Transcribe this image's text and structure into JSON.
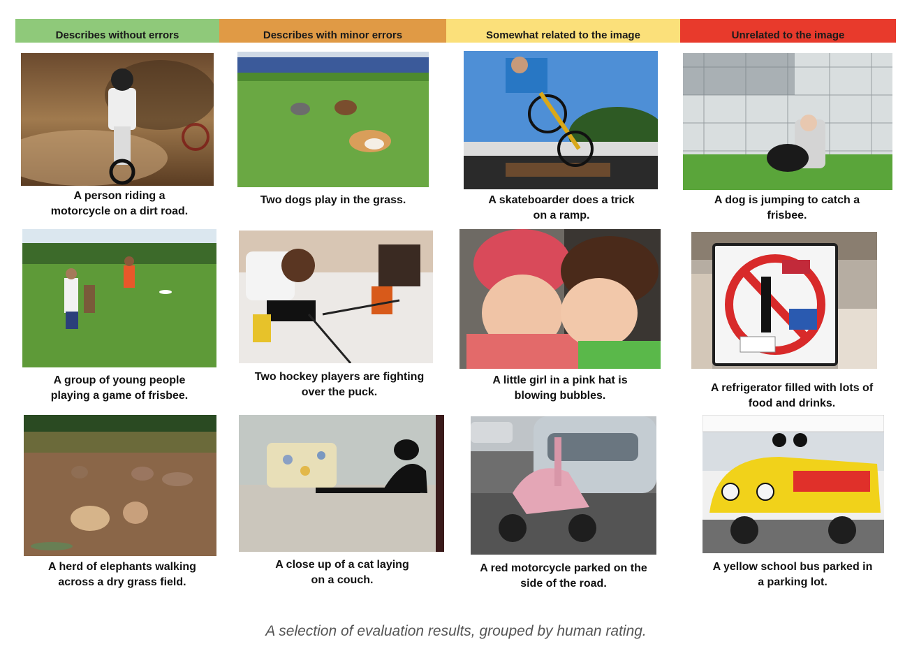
{
  "categories": [
    {
      "label": "Describes without errors",
      "color": "#8fc97a"
    },
    {
      "label": "Describes with minor errors",
      "color": "#e09a45"
    },
    {
      "label": "Somewhat related to the image",
      "color": "#fbe07a"
    },
    {
      "label": "Unrelated to the image",
      "color": "#e83a2c"
    }
  ],
  "rows": [
    [
      {
        "caption": "A person riding a\nmotorcycle on a dirt road.",
        "photo": "motocross-rider"
      },
      {
        "caption": "Two dogs play in the grass.",
        "photo": "dogs-running-on-grass"
      },
      {
        "caption": "A skateboarder does a trick\non a ramp.",
        "photo": "bmx-rider-on-ramp"
      },
      {
        "caption": "A dog is jumping to catch a\nfrisbee.",
        "photo": "woman-with-dog-by-fence"
      }
    ],
    [
      {
        "caption": "A group of young people\nplaying a game of frisbee.",
        "photo": "frisbee-players-on-field"
      },
      {
        "caption": "Two hockey players are fighting\nover the puck.",
        "photo": "hockey-players-on-ice"
      },
      {
        "caption": "A little girl in a pink hat is\nblowing bubbles.",
        "photo": "children-in-winter-hats"
      },
      {
        "caption": "A refrigerator filled with lots of\nfood and drinks.",
        "photo": "no-parking-sign-with-stickers"
      }
    ],
    [
      {
        "caption": "A herd of elephants walking\nacross a dry grass field.",
        "photo": "elephant-herd"
      },
      {
        "caption": "A close up of a cat laying\non a couch.",
        "photo": "black-cat-on-couch"
      },
      {
        "caption": "A red motorcycle parked on the\nside of the road.",
        "photo": "pink-scooter-in-parking-lot"
      },
      {
        "caption": "A yellow school bus parked in\na parking lot.",
        "photo": "yellow-beetle-limousine"
      }
    ]
  ],
  "figure_caption": "A selection of evaluation results, grouped by human rating."
}
